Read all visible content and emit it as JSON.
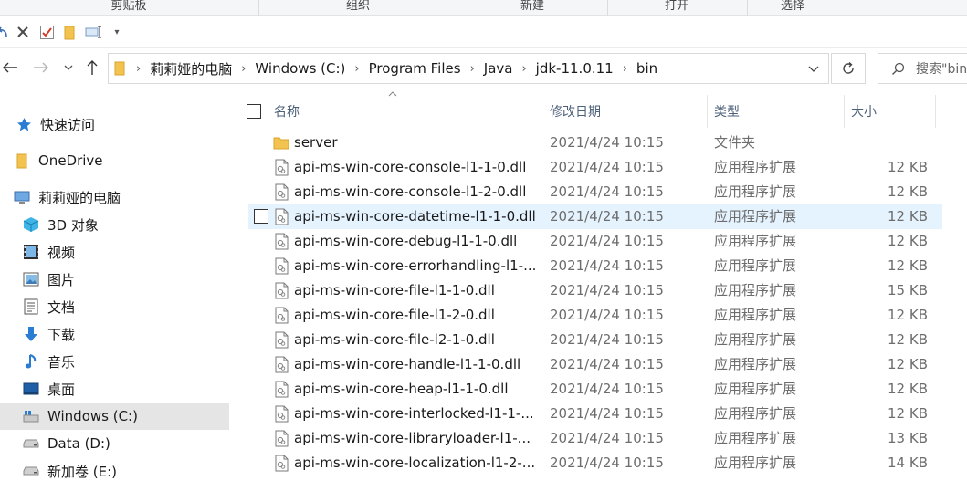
{
  "ribbon": {
    "groups": [
      "剪贴板",
      "组织",
      "新建",
      "打开",
      "选择"
    ]
  },
  "qat": {
    "icons": [
      "undo-icon",
      "delete-icon",
      "properties-icon",
      "new-folder-icon",
      "rename-icon",
      "customize-dropdown-icon"
    ]
  },
  "address": {
    "segments": [
      "莉莉娅的电脑",
      "Windows (C:)",
      "Program Files",
      "Java",
      "jdk-11.0.11",
      "bin"
    ],
    "search_placeholder": "搜索\"bin\""
  },
  "sidebar": {
    "items": [
      {
        "label": "快速访问",
        "icon": "star-icon"
      },
      {
        "label": "OneDrive",
        "icon": "onedrive-folder-icon"
      },
      {
        "label": "莉莉娅的电脑",
        "icon": "computer-icon"
      },
      {
        "label": "3D 对象",
        "icon": "3d-objects-icon"
      },
      {
        "label": "视频",
        "icon": "video-icon"
      },
      {
        "label": "图片",
        "icon": "pictures-icon"
      },
      {
        "label": "文档",
        "icon": "documents-icon"
      },
      {
        "label": "下载",
        "icon": "download-icon"
      },
      {
        "label": "音乐",
        "icon": "music-icon"
      },
      {
        "label": "桌面",
        "icon": "desktop-icon"
      },
      {
        "label": "Windows (C:)",
        "icon": "windows-drive-icon"
      },
      {
        "label": "Data (D:)",
        "icon": "drive-icon"
      },
      {
        "label": "新加卷 (E:)",
        "icon": "drive-icon"
      }
    ]
  },
  "columns": {
    "name": "名称",
    "date": "修改日期",
    "type": "类型",
    "size": "大小"
  },
  "files": [
    {
      "name": "server",
      "date": "2021/4/24 10:15",
      "type": "文件夹",
      "size": "",
      "kind": "folder"
    },
    {
      "name": "api-ms-win-core-console-l1-1-0.dll",
      "date": "2021/4/24 10:15",
      "type": "应用程序扩展",
      "size": "12 KB",
      "kind": "dll"
    },
    {
      "name": "api-ms-win-core-console-l1-2-0.dll",
      "date": "2021/4/24 10:15",
      "type": "应用程序扩展",
      "size": "12 KB",
      "kind": "dll"
    },
    {
      "name": "api-ms-win-core-datetime-l1-1-0.dll",
      "date": "2021/4/24 10:15",
      "type": "应用程序扩展",
      "size": "12 KB",
      "kind": "dll"
    },
    {
      "name": "api-ms-win-core-debug-l1-1-0.dll",
      "date": "2021/4/24 10:15",
      "type": "应用程序扩展",
      "size": "12 KB",
      "kind": "dll"
    },
    {
      "name": "api-ms-win-core-errorhandling-l1-...",
      "date": "2021/4/24 10:15",
      "type": "应用程序扩展",
      "size": "12 KB",
      "kind": "dll"
    },
    {
      "name": "api-ms-win-core-file-l1-1-0.dll",
      "date": "2021/4/24 10:15",
      "type": "应用程序扩展",
      "size": "15 KB",
      "kind": "dll"
    },
    {
      "name": "api-ms-win-core-file-l1-2-0.dll",
      "date": "2021/4/24 10:15",
      "type": "应用程序扩展",
      "size": "12 KB",
      "kind": "dll"
    },
    {
      "name": "api-ms-win-core-file-l2-1-0.dll",
      "date": "2021/4/24 10:15",
      "type": "应用程序扩展",
      "size": "12 KB",
      "kind": "dll"
    },
    {
      "name": "api-ms-win-core-handle-l1-1-0.dll",
      "date": "2021/4/24 10:15",
      "type": "应用程序扩展",
      "size": "12 KB",
      "kind": "dll"
    },
    {
      "name": "api-ms-win-core-heap-l1-1-0.dll",
      "date": "2021/4/24 10:15",
      "type": "应用程序扩展",
      "size": "12 KB",
      "kind": "dll"
    },
    {
      "name": "api-ms-win-core-interlocked-l1-1-...",
      "date": "2021/4/24 10:15",
      "type": "应用程序扩展",
      "size": "12 KB",
      "kind": "dll"
    },
    {
      "name": "api-ms-win-core-libraryloader-l1-...",
      "date": "2021/4/24 10:15",
      "type": "应用程序扩展",
      "size": "13 KB",
      "kind": "dll"
    },
    {
      "name": "api-ms-win-core-localization-l1-2-...",
      "date": "2021/4/24 10:15",
      "type": "应用程序扩展",
      "size": "14 KB",
      "kind": "dll"
    }
  ],
  "hovered_row_index": 3,
  "colors": {
    "hover": "#e5f3ff",
    "selected_nav": "#e5e5e5",
    "folder": "#f2c44f",
    "accent": "#0a64c8"
  }
}
